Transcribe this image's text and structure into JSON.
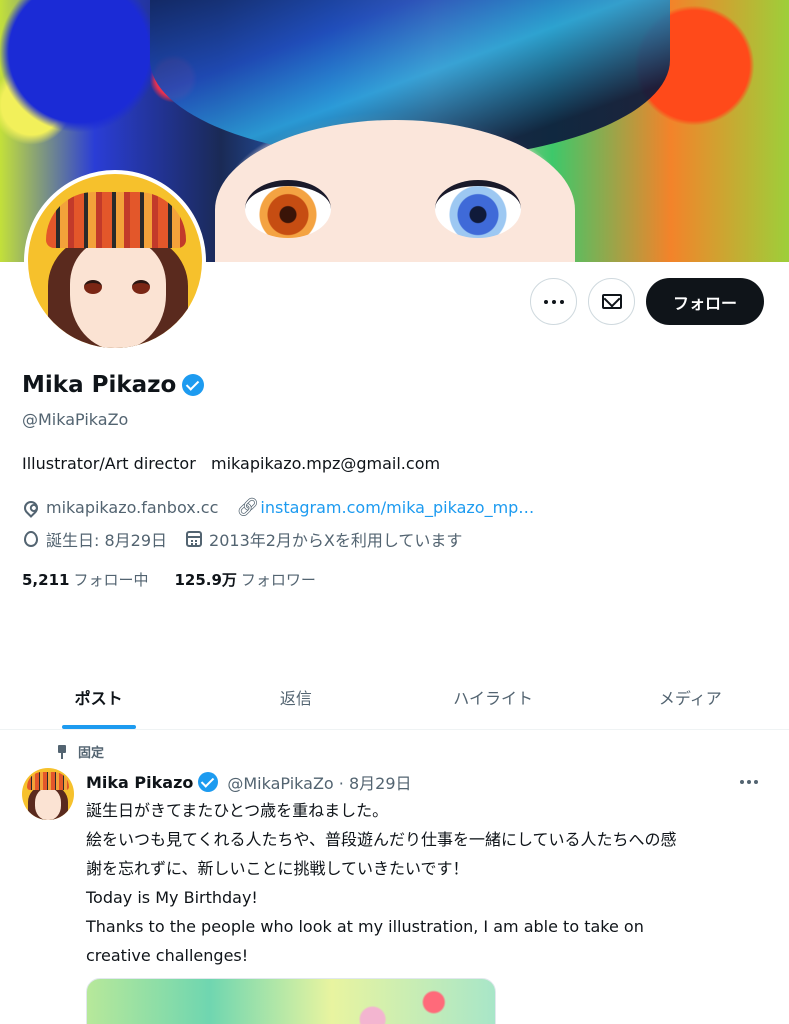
{
  "profile": {
    "display_name": "Mika Pikazo",
    "handle": "@MikaPikaZo",
    "bio": "Illustrator/Art director   mikapikazo.mpz@gmail.com",
    "website": "mikapikazo.fanbox.cc",
    "link": "instagram.com/mika_pikazo_mp…",
    "birthday": "誕生日: 8月29日",
    "joined": "2013年2月からXを利用しています",
    "following_count": "5,211",
    "following_label": "フォロー中",
    "followers_count": "125.9万",
    "followers_label": "フォロワー"
  },
  "actions": {
    "follow_label": "フォロー"
  },
  "tabs": [
    {
      "label": "ポスト",
      "active": true
    },
    {
      "label": "返信",
      "active": false
    },
    {
      "label": "ハイライト",
      "active": false
    },
    {
      "label": "メディア",
      "active": false
    }
  ],
  "post": {
    "pinned_label": "固定",
    "author": "Mika Pikazo",
    "meta": "@MikaPikaZo · 8月29日",
    "lines": [
      "誕生日がきてまたひとつ歳を重ねました。",
      "絵をいつも見てくれる人たちや、普段遊んだり仕事を一緒にしている人たちへの感",
      "謝を忘れずに、新しいことに挑戦していきたいです！",
      "Today is My Birthday!",
      "Thanks to the people who look at my illustration, I am able to take on",
      "creative challenges!"
    ]
  },
  "colors": {
    "accent": "#1d9bf0",
    "text": "#0f1419",
    "secondary": "#536471",
    "follow_button": "#0f1419"
  },
  "icons": [
    "more-icon",
    "mail-icon",
    "verified-icon",
    "location-icon",
    "link-icon",
    "birthday-icon",
    "calendar-icon",
    "pin-icon"
  ]
}
